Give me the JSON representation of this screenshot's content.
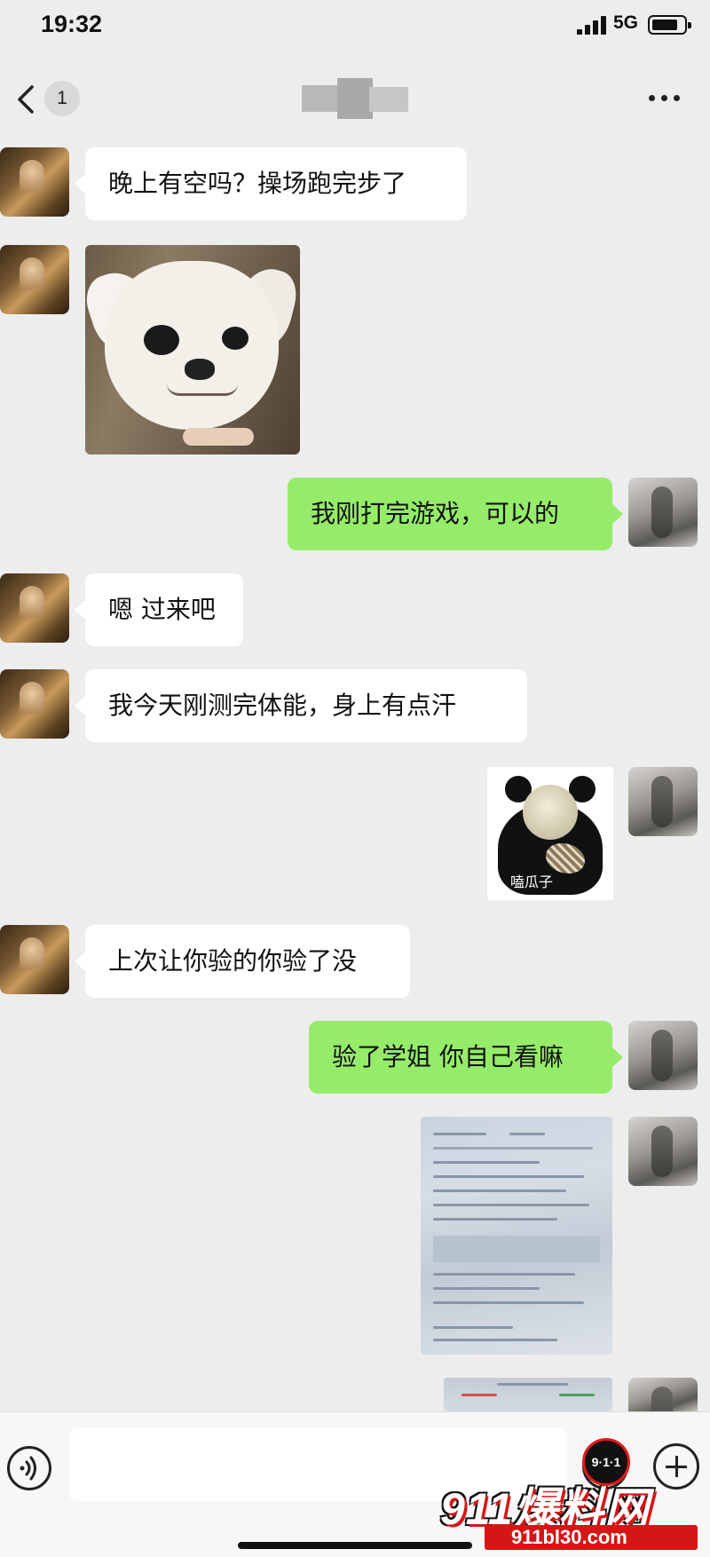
{
  "status_bar": {
    "time": "19:32",
    "network": "5G"
  },
  "header": {
    "unread_count": "1"
  },
  "messages": [
    {
      "from": "contact",
      "type": "text",
      "text": "晚上有空吗？操场跑完步了"
    },
    {
      "from": "contact",
      "type": "sticker",
      "subject": "chihuahua"
    },
    {
      "from": "me",
      "type": "text",
      "text": "我刚打完游戏，可以的"
    },
    {
      "from": "contact",
      "type": "text",
      "text": "嗯 过来吧"
    },
    {
      "from": "contact",
      "type": "text",
      "text": "我今天刚测完体能，身上有点汗"
    },
    {
      "from": "me",
      "type": "sticker",
      "subject": "panda-eating-seeds",
      "caption": "嗑瓜子"
    },
    {
      "from": "contact",
      "type": "text",
      "text": "上次让你验的你验了没"
    },
    {
      "from": "me",
      "type": "text",
      "text": "验了学姐 你自己看嘛"
    },
    {
      "from": "me",
      "type": "image",
      "subject": "medical-report-photo"
    },
    {
      "from": "me",
      "type": "image",
      "subject": "medical-report-photo"
    }
  ],
  "input_bar": {
    "placeholder": ""
  },
  "watermark": {
    "badge": "9·1·1",
    "brand": "911爆料网",
    "url": "911bl30.com"
  },
  "colors": {
    "background": "#ededed",
    "incoming_bubble": "#ffffff",
    "outgoing_bubble": "#95ec69"
  },
  "icons": [
    "back-icon",
    "more-icon",
    "voice-icon",
    "emoji-icon",
    "plus-icon"
  ]
}
